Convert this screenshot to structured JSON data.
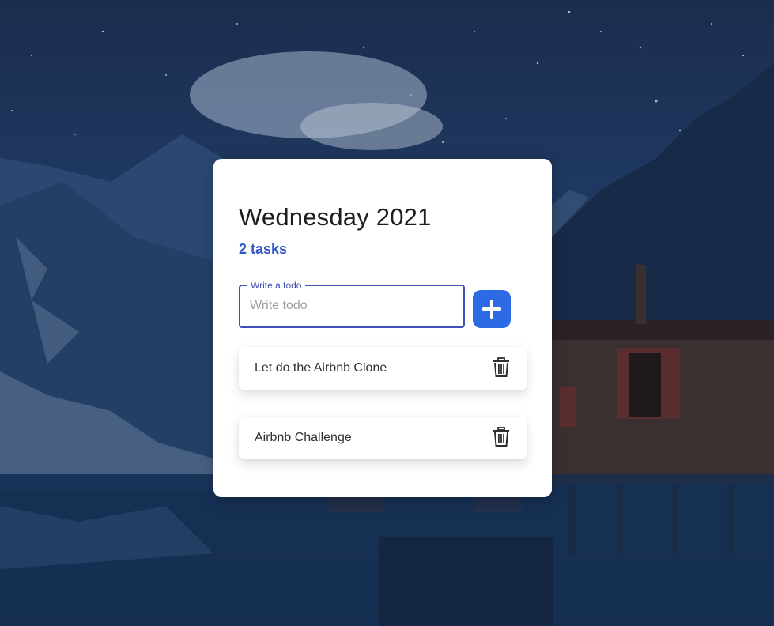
{
  "header": {
    "title": "Wednesday 2021",
    "task_count": "2 tasks"
  },
  "input": {
    "label": "Write a todo",
    "placeholder": "Write todo",
    "value": ""
  },
  "add_button": {
    "icon": "plus-icon"
  },
  "todos": [
    {
      "text": "Let do the Airbnb Clone",
      "icon": "trash-icon"
    },
    {
      "text": "Airbnb Challenge",
      "icon": "trash-icon"
    }
  ],
  "colors": {
    "accent": "#2d6ae6",
    "count_text": "#2f55c8",
    "field_border": "#3f51b5",
    "card_bg": "#ffffff",
    "background": "#1f3a64"
  }
}
